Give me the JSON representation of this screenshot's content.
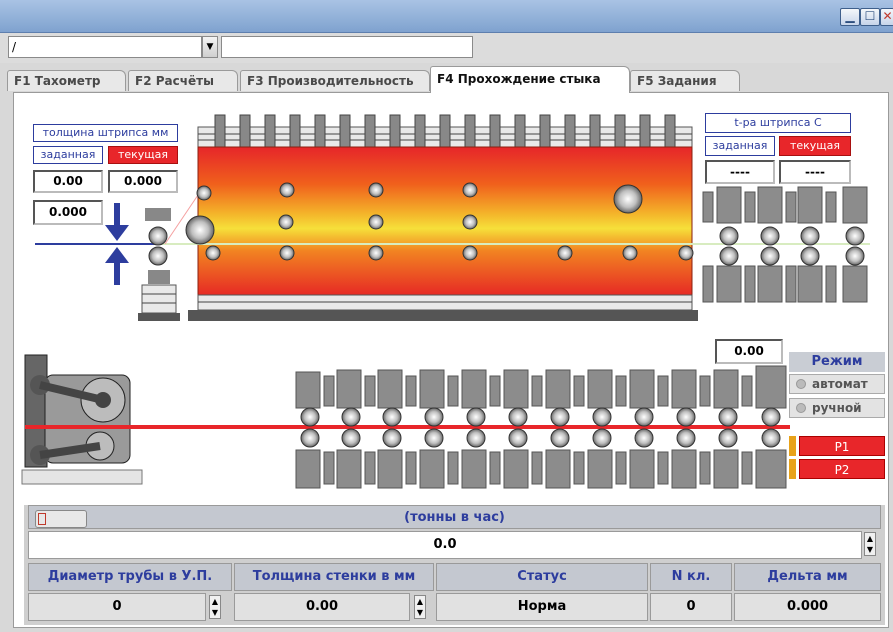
{
  "toolbar": {
    "combo_value": "/",
    "combo_arrow": "▼"
  },
  "tabs": [
    {
      "label": "F1 Тахометр"
    },
    {
      "label": "F2 Расчёты"
    },
    {
      "label": "F3 Производительность"
    },
    {
      "label": "F4 Прохождение стыка"
    },
    {
      "label": "F5 Задания"
    }
  ],
  "thickness": {
    "title": "толщина штрипса мм",
    "set_label": "заданная",
    "current_label": "текущая",
    "set_value": "0.00",
    "current_value": "0.000",
    "gap_value": "0.000"
  },
  "temperature": {
    "title": "t-ра штрипса С",
    "set_label": "заданная",
    "current_label": "текущая",
    "set_value": "----",
    "current_value": "----"
  },
  "stand_value": "0.00",
  "mode": {
    "title": "Режим",
    "auto_label": "автомат",
    "manual_label": "ручной"
  },
  "p1_label": "P1",
  "p2_label": "P2",
  "throughput": {
    "label": "(тонны в час)",
    "value": "0.0"
  },
  "table": {
    "headers": [
      "Диаметр трубы в У.П.",
      "Толщина стенки в мм",
      "Статус",
      "N кл.",
      "Дельта мм"
    ],
    "values": [
      "0",
      "0.00",
      "Норма",
      "0",
      "0.000"
    ]
  },
  "colors": {
    "accent_blue": "#2d3d9e",
    "alarm_red": "#e8262a",
    "title_bar": "#8fb0da"
  }
}
